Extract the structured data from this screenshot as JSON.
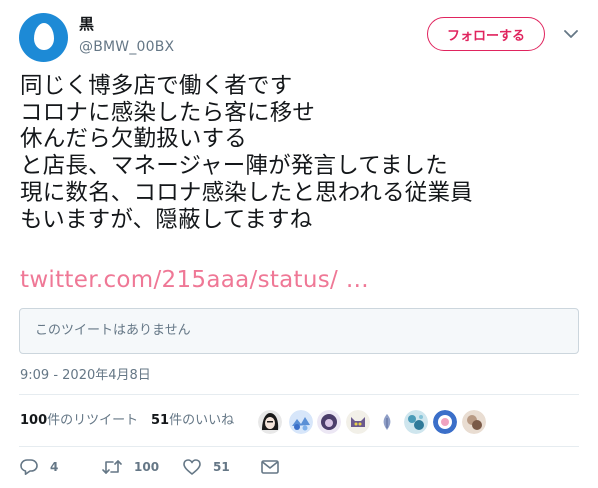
{
  "user": {
    "display_name": "黒",
    "handle": "@BMW_00BX",
    "avatar_icon": "default-egg-avatar-icon",
    "avatar_color": "#1d8ad6"
  },
  "follow_button": {
    "label": "フォローする",
    "color": "#e0245e"
  },
  "tweet": {
    "lines": [
      "同じく博多店で働く者です",
      "コロナに感染したら客に移せ",
      "休んだら欠勤扱いする",
      "と店長、マネージャー陣が発言してました",
      "現に数名、コロナ感染したと思われる従業員",
      "もいますが、隠蔽してますね"
    ],
    "link_text": "twitter.com/215aaa/status/ …",
    "link_color": "#ef7896"
  },
  "quoted_tweet": {
    "text": "このツイートはありません"
  },
  "timestamp": "9:09 - 2020年4月8日",
  "stats": {
    "retweets_count": "100",
    "retweets_label": "件のリツイート",
    "likes_count": "51",
    "likes_label": "件のいいね"
  },
  "likers": [
    {
      "name": "liker-avatar-1",
      "color": "#3a3a3a"
    },
    {
      "name": "liker-avatar-2",
      "color": "#5a8fd6"
    },
    {
      "name": "liker-avatar-3",
      "color": "#6b5a8e"
    },
    {
      "name": "liker-avatar-4",
      "color": "#7a6a3a"
    },
    {
      "name": "liker-avatar-5",
      "color": "#9aa7c7"
    },
    {
      "name": "liker-avatar-6",
      "color": "#4a9bb8"
    },
    {
      "name": "liker-avatar-7",
      "color": "#3b6fc9"
    },
    {
      "name": "liker-avatar-8",
      "color": "#b89a84"
    }
  ],
  "actions": {
    "reply_count": "4",
    "retweet_count": "100",
    "like_count": "51",
    "reply_icon": "reply-icon",
    "retweet_icon": "retweet-icon",
    "like_icon": "heart-icon",
    "dm_icon": "envelope-icon"
  }
}
